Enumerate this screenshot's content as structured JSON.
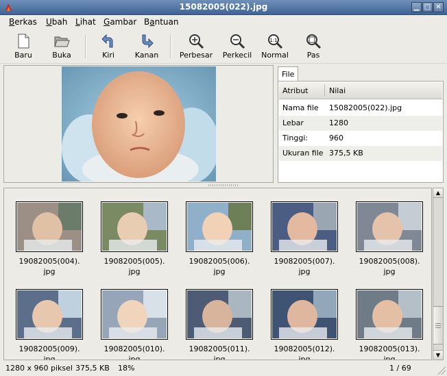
{
  "window": {
    "title": "15082005(022).jpg",
    "controls": {
      "minimize": "▁",
      "maximize": "□",
      "close": "✕"
    }
  },
  "menu": [
    {
      "label": "Berkas",
      "mnemonic": "B"
    },
    {
      "label": "Ubah",
      "mnemonic": "U"
    },
    {
      "label": "Lihat",
      "mnemonic": "L"
    },
    {
      "label": "Gambar",
      "mnemonic": "G"
    },
    {
      "label": "Bantuan",
      "mnemonic": "a"
    }
  ],
  "toolbar": {
    "new": "Baru",
    "open": "Buka",
    "rotate_left": "Kiri",
    "rotate_right": "Kanan",
    "zoom_in": "Perbesar",
    "zoom_out": "Perkecil",
    "zoom_normal": "Normal",
    "zoom_fit": "Pas"
  },
  "properties": {
    "tab": "File",
    "headers": {
      "attr": "Atribut",
      "value": "Nilai"
    },
    "rows": [
      {
        "attr": "Nama file",
        "value": "15082005(022).jpg"
      },
      {
        "attr": "Lebar",
        "value": "1280"
      },
      {
        "attr": "Tinggi:",
        "value": "960"
      },
      {
        "attr": "Ukuran file",
        "value": "375,5 KB"
      }
    ]
  },
  "thumbnails": [
    {
      "line1": "19082005(004).",
      "line2": "jpg"
    },
    {
      "line1": "19082005(005).",
      "line2": "jpg"
    },
    {
      "line1": "19082005(006).",
      "line2": "jpg"
    },
    {
      "line1": "19082005(007).",
      "line2": "jpg"
    },
    {
      "line1": "19082005(008).",
      "line2": "jpg"
    },
    {
      "line1": "19082005(009).",
      "line2": "jpg"
    },
    {
      "line1": "19082005(010).",
      "line2": "jpg"
    },
    {
      "line1": "19082005(011).",
      "line2": "jpg"
    },
    {
      "line1": "19082005(012).",
      "line2": "jpg"
    },
    {
      "line1": "19082005(013).",
      "line2": "jpg"
    }
  ],
  "status": {
    "dimensions": "1280 x 960 piksel",
    "size": "375,5 KB",
    "zoom": "18%",
    "position": "1 / 69"
  },
  "colors": {
    "titlebar": "#3f6496",
    "window_bg": "#ecebe6",
    "panel_bg": "#ffffff"
  }
}
